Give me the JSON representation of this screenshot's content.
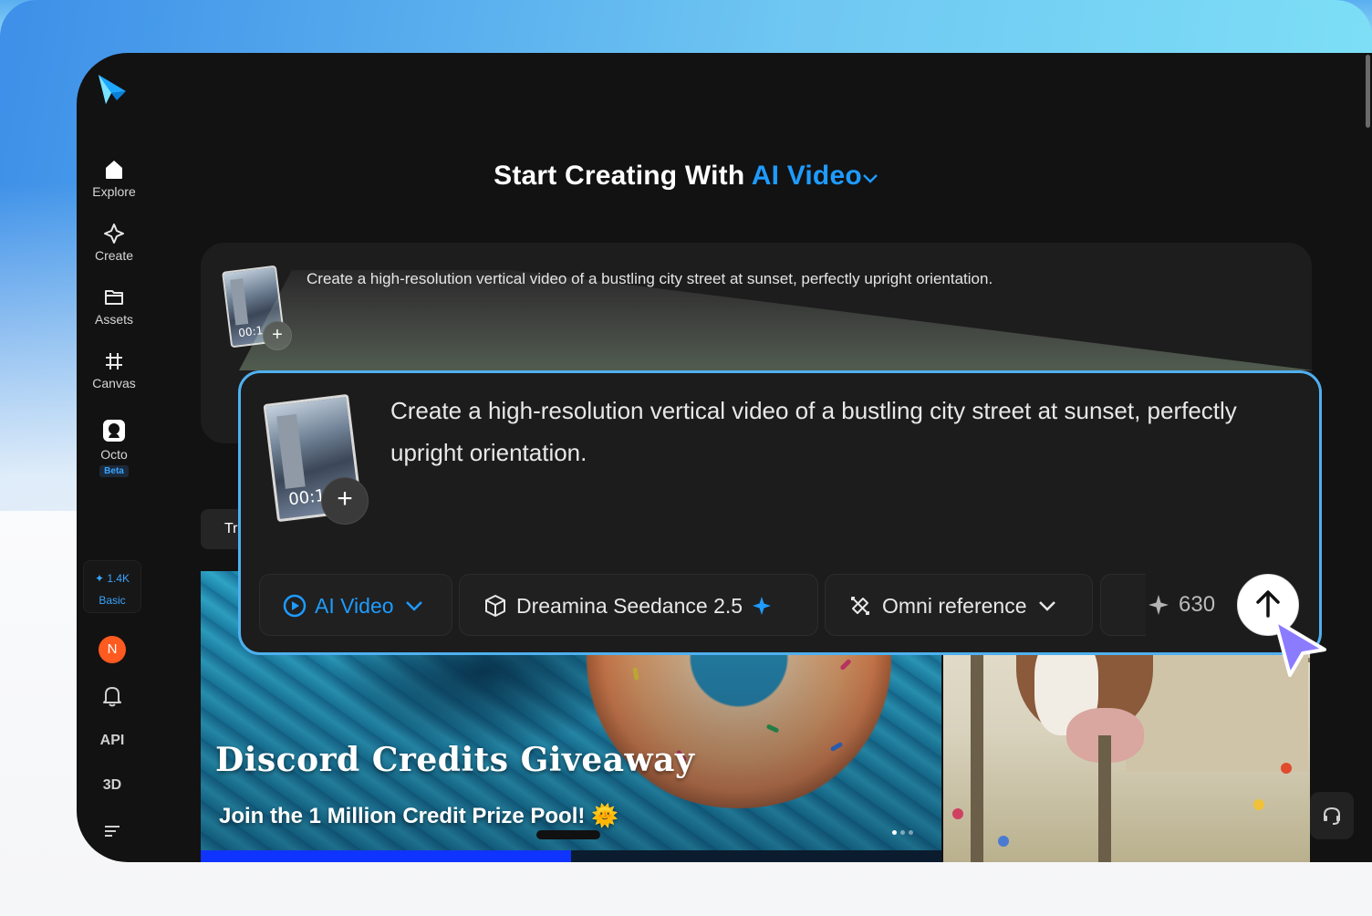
{
  "sidebar": {
    "items": [
      {
        "label": "Explore",
        "icon": "home-icon"
      },
      {
        "label": "Create",
        "icon": "sparkle-diamond-icon"
      },
      {
        "label": "Assets",
        "icon": "folder-icon"
      },
      {
        "label": "Canvas",
        "icon": "canvas-frame-icon"
      },
      {
        "label": "Octo",
        "icon": "octo-icon",
        "badge": "Beta"
      }
    ],
    "plan": {
      "credits": "1.4K",
      "tier": "Basic"
    },
    "avatar_initial": "N",
    "api_label": "API",
    "three_d_label": "3D"
  },
  "headline": {
    "prefix": "Start Creating With",
    "mode": "AI Video"
  },
  "prompt": {
    "text": "Create a high-resolution vertical video of a bustling city street at sunset, perfectly upright orientation.",
    "thumb_time": "00:1"
  },
  "try_chip": "Tr",
  "zoom": {
    "text": "Create a high-resolution vertical video of a bustling city street at sunset, perfectly upright orientation.",
    "thumb_time": "00:1",
    "mode_label": "AI Video",
    "model_label": "Dreamina Seedance 2.5",
    "reference_label": "Omni reference",
    "cost": "630"
  },
  "banner": {
    "title": "Discord Credits Giveaway",
    "subtitle": "Join the 1 Million Credit Prize Pool! 🌞",
    "progress": 0.5
  },
  "colors": {
    "accent": "#1e9bff",
    "zoom_border": "#4fb0ef",
    "cursor": "#8b7bff"
  }
}
